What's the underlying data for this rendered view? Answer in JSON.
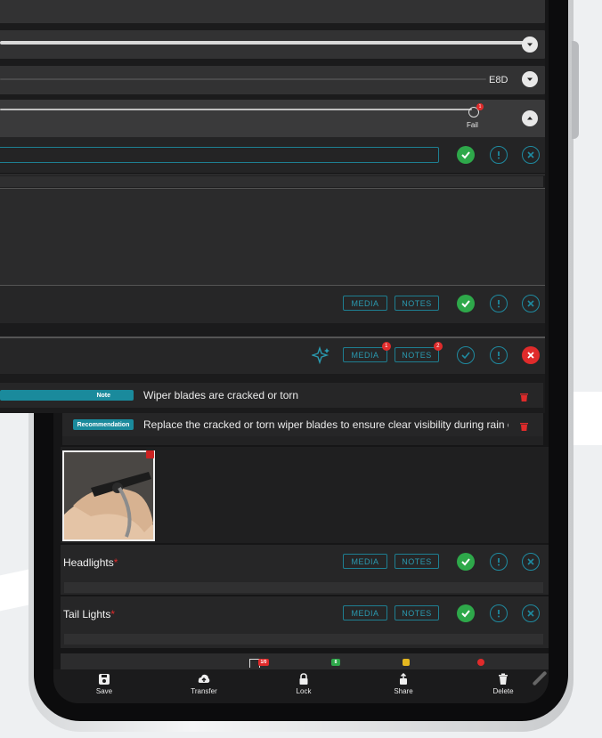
{
  "top_rows": {
    "row3": {
      "code": "E8D"
    },
    "row4": {
      "fail_label": "Fail",
      "fail_badge": "1"
    }
  },
  "items": {
    "item_a": {
      "media": "MEDIA",
      "notes": "NOTES"
    },
    "wipers": {
      "media": "MEDIA",
      "notes": "NOTES",
      "media_badge": "1",
      "notes_badge": "2"
    },
    "headlights": {
      "label": "Headlights",
      "req": "*",
      "media": "MEDIA",
      "notes": "NOTES"
    },
    "tail_lights": {
      "label": "Tail Lights",
      "req": "*",
      "media": "MEDIA",
      "notes": "NOTES"
    }
  },
  "notes": [
    {
      "tag": "Note",
      "text": "Wiper blades are cracked or torn"
    },
    {
      "tag": "Recommendation",
      "text": "Replace the cracked or torn wiper blades to ensure clear visibility during rain or s"
    }
  ],
  "bottom_bar": {
    "save": "Save",
    "transfer": "Transfer",
    "lock": "Lock",
    "share": "Share",
    "delete": "Delete"
  },
  "summary_badges": {
    "warn_count": "1/0",
    "ok_count": "8"
  },
  "colors": {
    "accent": "#1f8aa0",
    "pass": "#2ea84a",
    "fail": "#e02b2b",
    "note_tag": "#1a8a9c"
  }
}
